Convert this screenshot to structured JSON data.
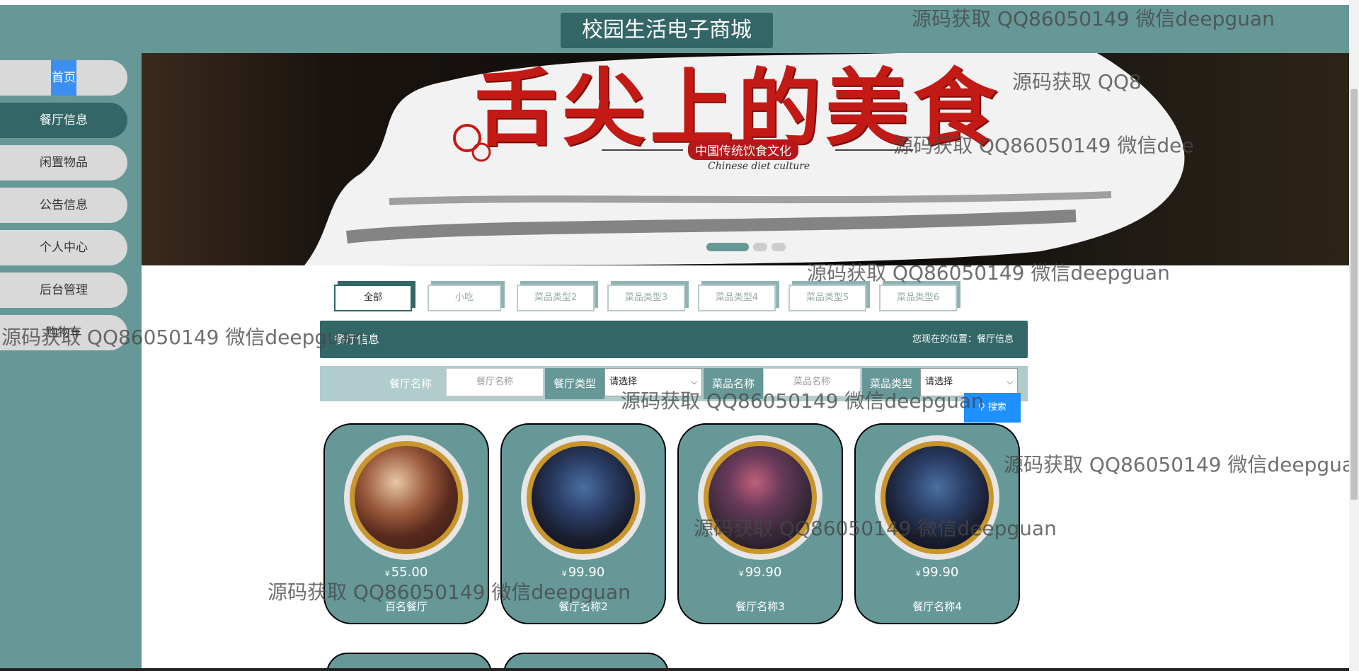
{
  "header": {
    "title": "校园生活电子商城"
  },
  "sidebar": {
    "items": [
      {
        "label": "首页"
      },
      {
        "label": "餐厅信息"
      },
      {
        "label": "闲置物品"
      },
      {
        "label": "公告信息"
      },
      {
        "label": "个人中心"
      },
      {
        "label": "后台管理"
      },
      {
        "label": "购物车"
      }
    ]
  },
  "banner": {
    "title": "舌尖上的美食",
    "subtitle": "中国传统饮食文化",
    "english": "Chinese diet culture"
  },
  "tabs": [
    {
      "label": "全部"
    },
    {
      "label": "小吃"
    },
    {
      "label": "菜品类型2"
    },
    {
      "label": "菜品类型3"
    },
    {
      "label": "菜品类型4"
    },
    {
      "label": "菜品类型5"
    },
    {
      "label": "菜品类型6"
    }
  ],
  "info_bar": {
    "title": "餐厅信息",
    "location": "您现在的位置：餐厅信息"
  },
  "search": {
    "restaurant_name_label": "餐厅名称",
    "restaurant_name_placeholder": "餐厅名称",
    "restaurant_type_label": "餐厅类型",
    "restaurant_type_value": "请选择",
    "dish_name_label": "菜品名称",
    "dish_name_placeholder": "菜品名称",
    "dish_type_label": "菜品类型",
    "dish_type_value": "请选择",
    "button_label": "搜索"
  },
  "cards": [
    {
      "yen": "¥",
      "price": "55.00",
      "name": "百名餐厅"
    },
    {
      "yen": "¥",
      "price": "99.90",
      "name": "餐厅名称2"
    },
    {
      "yen": "¥",
      "price": "99.90",
      "name": "餐厅名称3"
    },
    {
      "yen": "¥",
      "price": "99.90",
      "name": "餐厅名称4"
    }
  ],
  "watermarks": [
    {
      "text": "源码获取 QQ86050149 微信deepguan"
    },
    {
      "text": "源码获取 QQ8"
    },
    {
      "text": "源码获取 QQ86050149 微信dee"
    },
    {
      "text": "源码获取 QQ86050149 微信deepguan"
    },
    {
      "text": "源码获取 QQ86050149 微信deepguan"
    },
    {
      "text": "源码获取 QQ86050149 微信deepguan"
    },
    {
      "text": "源码获取 QQ86050149 微信deepgua"
    },
    {
      "text": "源码获取 QQ86050149 微信deepguan"
    },
    {
      "text": "源码获取 QQ86050149 微信deepguan"
    }
  ]
}
